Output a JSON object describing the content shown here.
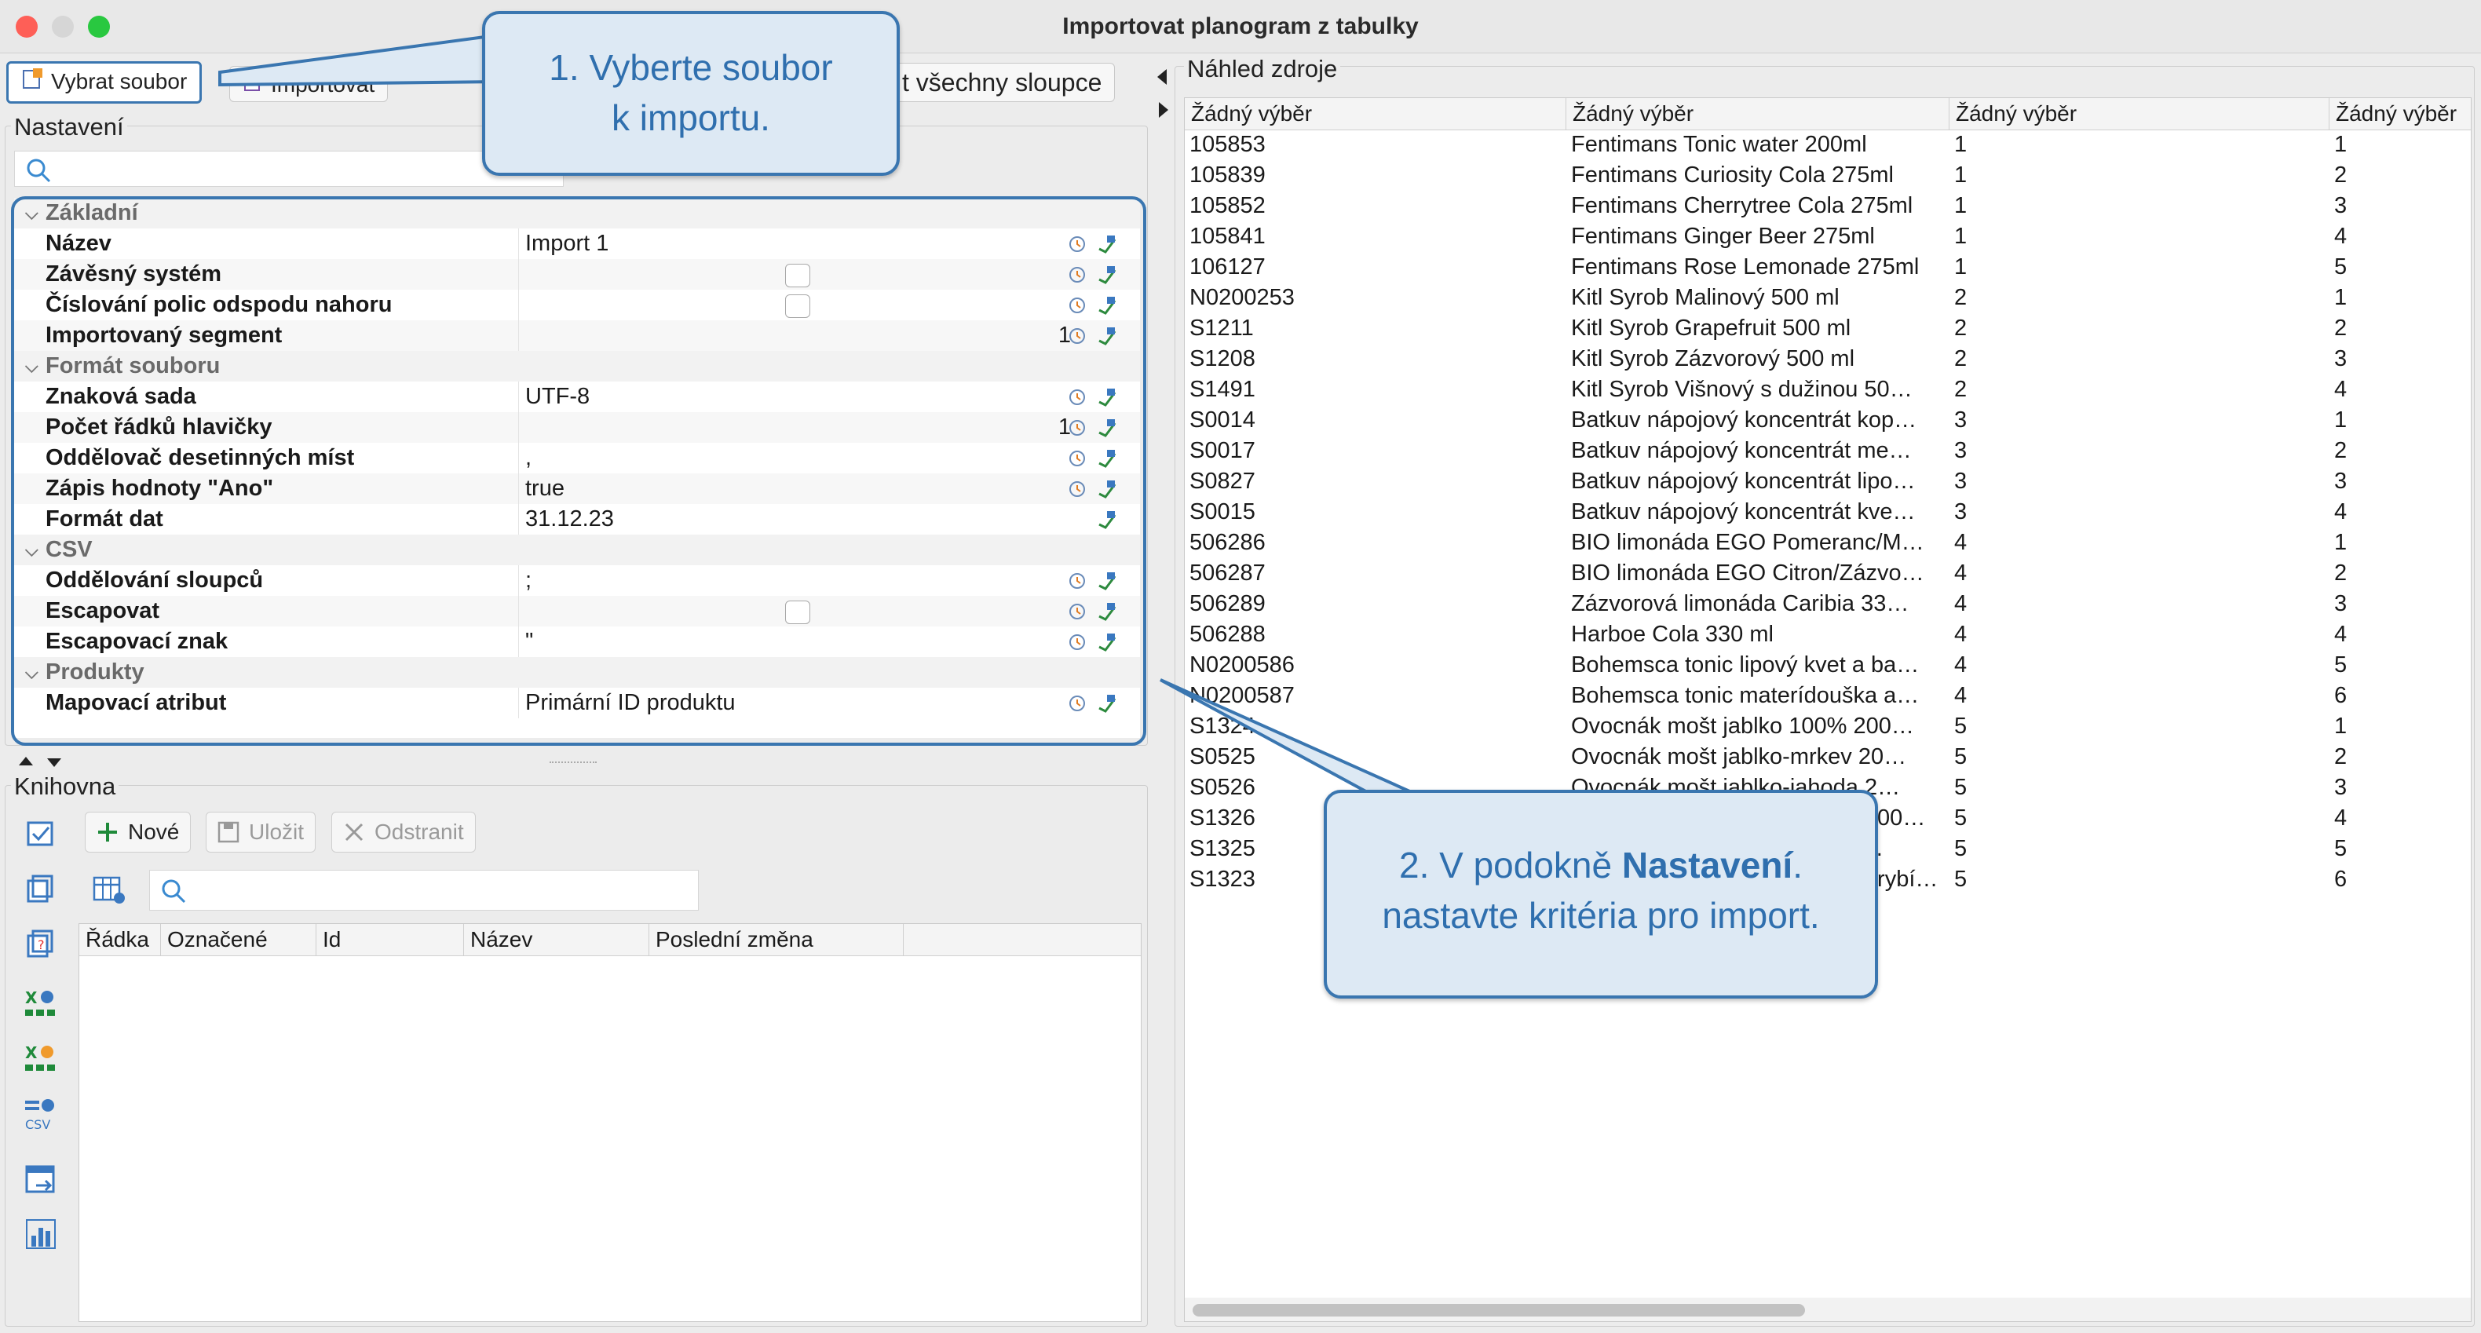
{
  "window": {
    "title": "Importovat planogram z tabulky",
    "colors": {
      "close": "#fe5f57",
      "minimize": "#d6d6d6",
      "zoom": "#29c840",
      "accent": "#3a76b0"
    }
  },
  "toolbar": {
    "select_file": "Vybrat soubor",
    "import": "Importovat",
    "all_columns": "t všechny sloupce"
  },
  "settings": {
    "group_label": "Nastavení",
    "sections": [
      {
        "title": "Základní",
        "rows": [
          {
            "label": "Název",
            "value": "Import 1"
          },
          {
            "label": "Závěsný systém",
            "value": ""
          },
          {
            "label": "Číslování polic odspodu nahoru",
            "value": ""
          },
          {
            "label": "Importovaný segment",
            "value": "1"
          }
        ]
      },
      {
        "title": "Formát souboru",
        "rows": [
          {
            "label": "Znaková sada",
            "value": "UTF-8"
          },
          {
            "label": "Počet řádků hlavičky",
            "value": "1"
          },
          {
            "label": "Oddělovač desetinných míst",
            "value": ","
          },
          {
            "label": "Zápis hodnoty \"Ano\"",
            "value": "true"
          },
          {
            "label": "Formát dat",
            "value": "31.12.23"
          }
        ]
      },
      {
        "title": "CSV",
        "rows": [
          {
            "label": "Oddělování sloupců",
            "value": ";"
          },
          {
            "label": "Escapovat",
            "value": ""
          },
          {
            "label": "Escapovací znak",
            "value": "\""
          }
        ]
      },
      {
        "title": "Produkty",
        "rows": [
          {
            "label": "Mapovací atribut",
            "value": "Primární ID produktu"
          }
        ]
      }
    ]
  },
  "library": {
    "group_label": "Knihovna",
    "new": "Nové",
    "save": "Uložit",
    "delete": "Odstranit",
    "columns": [
      "Řádka",
      "Označené",
      "Id",
      "Název",
      "Poslední změna"
    ]
  },
  "preview": {
    "label": "Náhled zdroje",
    "headers": [
      "Žádný výběr",
      "Žádný výběr",
      "Žádný výběr",
      "Žádný výběr"
    ],
    "rows": [
      [
        "105853",
        "Fentimans Tonic water 200ml",
        "1",
        "1"
      ],
      [
        "105839",
        "Fentimans Curiosity Cola 275ml",
        "1",
        "2"
      ],
      [
        "105852",
        "Fentimans Cherrytree Cola 275ml",
        "1",
        "3"
      ],
      [
        "105841",
        "Fentimans Ginger Beer 275ml",
        "1",
        "4"
      ],
      [
        "106127",
        "Fentimans Rose Lemonade 275ml",
        "1",
        "5"
      ],
      [
        "N0200253",
        "Kitl Syrob Malinový 500 ml",
        "2",
        "1"
      ],
      [
        "S1211",
        "Kitl Syrob Grapefruit 500 ml",
        "2",
        "2"
      ],
      [
        "S1208",
        "Kitl Syrob Zázvorový 500 ml",
        "2",
        "3"
      ],
      [
        "S1491",
        "Kitl Syrob Višnový s dužinou 50…",
        "2",
        "4"
      ],
      [
        "S0014",
        "Batkuv nápojový koncentrát kop…",
        "3",
        "1"
      ],
      [
        "S0017",
        "Batkuv nápojový koncentrát me…",
        "3",
        "2"
      ],
      [
        "S0827",
        "Batkuv nápojový koncentrát lipo…",
        "3",
        "3"
      ],
      [
        "S0015",
        "Batkuv nápojový koncentrát kve…",
        "3",
        "4"
      ],
      [
        "506286",
        "BIO limonáda EGO Pomeranc/M…",
        "4",
        "1"
      ],
      [
        "506287",
        "BIO limonáda EGO Citron/Zázvo…",
        "4",
        "2"
      ],
      [
        "506289",
        "Zázvorová limonáda Caribia 33…",
        "4",
        "3"
      ],
      [
        "506288",
        "Harboe Cola 330 ml",
        "4",
        "4"
      ],
      [
        "N0200586",
        "Bohemsca tonic lipový kvet a ba…",
        "4",
        "5"
      ],
      [
        "N0200587",
        "Bohemsca tonic materídouška a…",
        "4",
        "6"
      ],
      [
        "S1324",
        "Ovocnák mošt jablko 100% 200…",
        "5",
        "1"
      ],
      [
        "S0525",
        "Ovocnák mošt jablko-mrkev 20…",
        "5",
        "2"
      ],
      [
        "S0526",
        "Ovocnák mošt jablko-jahoda 2…",
        "5",
        "3"
      ],
      [
        "S1326",
        "Ovocnák mošt jablko-hruška 100…",
        "5",
        "4"
      ],
      [
        "S1325",
        "Ovocnák mošt jablko-černá r…",
        "5",
        "5"
      ],
      [
        "S1323",
        "Ovocnák mošt jablko-červená rybí…",
        "5",
        "6"
      ]
    ]
  },
  "callouts": {
    "one_line1": "1. Vyberte soubor",
    "one_line2": "k importu.",
    "two_prefix": "2. V podokně ",
    "two_bold": "Nastavení",
    "two_line2": "nastavte kritéria pro import."
  }
}
